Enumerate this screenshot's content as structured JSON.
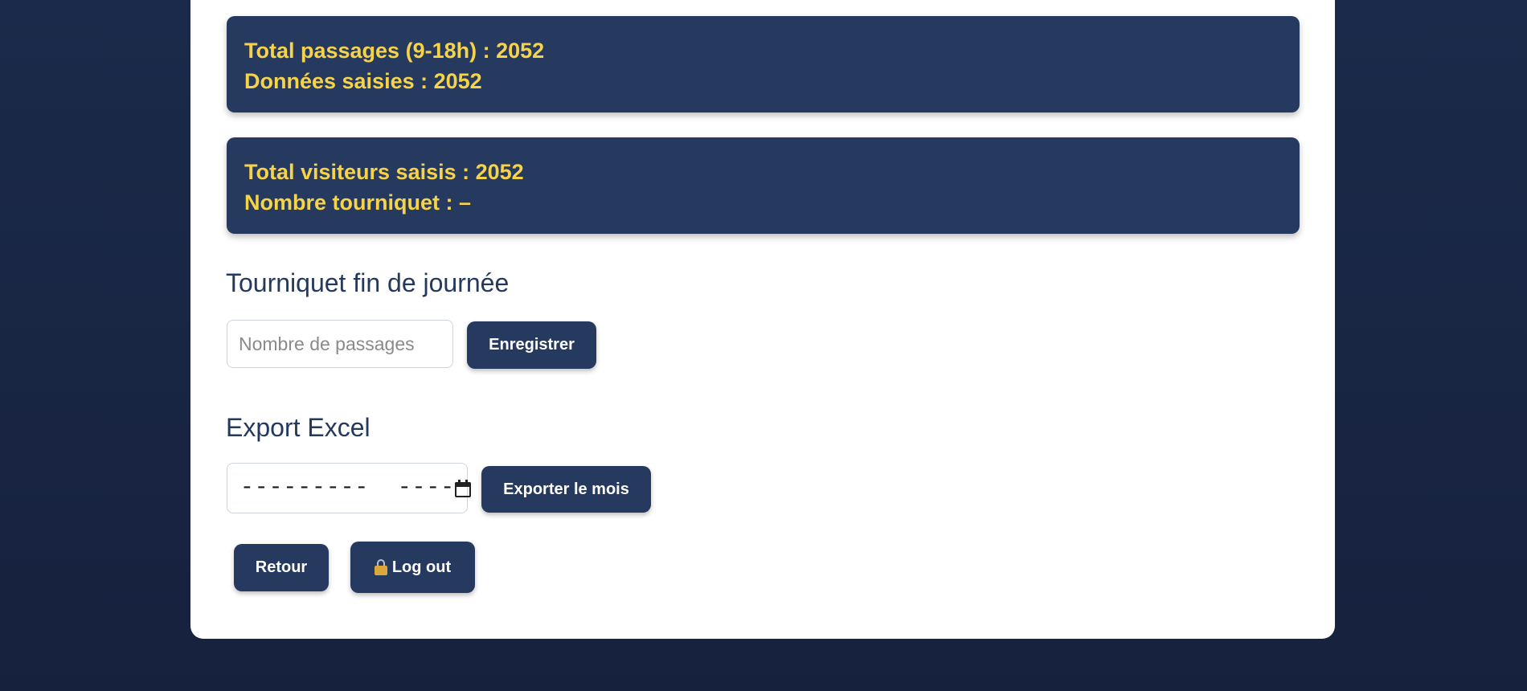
{
  "stats": {
    "passages_line": "Total passages (9-18h) : 2052",
    "saisies_line": "Données saisies : 2052",
    "visiteurs_line": "Total visiteurs saisis : 2052",
    "tourniquet_line": "Nombre tourniquet : –"
  },
  "turnstile": {
    "title": "Tourniquet fin de journée",
    "input_placeholder": "Nombre de passages",
    "input_value": "",
    "save_label": "Enregistrer"
  },
  "export": {
    "title": "Export Excel",
    "month_mask": "---------  ----",
    "export_label": "Exporter le mois"
  },
  "footer": {
    "back_label": "Retour",
    "logout_label": "Log out"
  },
  "icons": {
    "calendar": "calendar-icon",
    "lock": "lock-icon"
  },
  "colors": {
    "page_background": "#1b2a4a",
    "accent": "#253a5e",
    "stat_text": "#f7d34a"
  }
}
